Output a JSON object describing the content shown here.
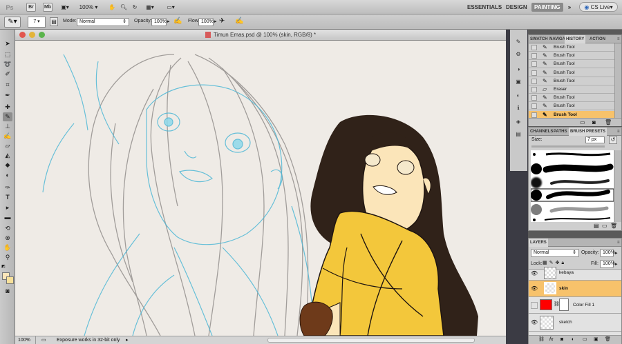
{
  "appbar": {
    "logo": "Ps",
    "zoom": "100%",
    "workspaces": [
      "ESSENTIALS",
      "DESIGN",
      "PAINTING"
    ],
    "active_workspace": "PAINTING",
    "cs_live": "CS Live"
  },
  "options": {
    "brush_size": "7",
    "mode_label": "Mode:",
    "mode_value": "Normal",
    "opacity_label": "Opacity:",
    "opacity_value": "100%",
    "flow_label": "Flow:",
    "flow_value": "100%"
  },
  "document": {
    "title": "Timun Emas.psd @ 100% (skin, RGB/8) *",
    "zoom": "100%",
    "status": "Exposure works in 32-bit only"
  },
  "history": {
    "tabs": [
      "SWATCH",
      "NAVIGA",
      "HISTORY",
      "ACTION"
    ],
    "active_tab": "HISTORY",
    "items": [
      "Brush Tool",
      "Brush Tool",
      "Brush Tool",
      "Brush Tool",
      "Brush Tool",
      "Eraser",
      "Brush Tool",
      "Brush Tool",
      "Brush Tool"
    ],
    "selected_index": 8
  },
  "brush_presets": {
    "tabs": [
      "CHANNELS",
      "PATHS",
      "BRUSH PRESETS"
    ],
    "active_tab": "BRUSH PRESETS",
    "size_label": "Size:",
    "size_value": "7 px"
  },
  "layers": {
    "title": "LAYERS",
    "blend_mode": "Normal",
    "opacity_label": "Opacity:",
    "opacity_value": "100%",
    "lock_label": "Lock:",
    "fill_label": "Fill:",
    "fill_value": "100%",
    "items": [
      {
        "name": "kebaya",
        "selected": false
      },
      {
        "name": "skin",
        "selected": true
      },
      {
        "name": "Color Fill 1",
        "selected": false
      },
      {
        "name": "sketch",
        "selected": false
      }
    ]
  },
  "colors": {
    "selection": "#f7c26b",
    "fill_swatch": "#ff0000",
    "kebaya": "#f3c73b",
    "skin": "#fbe5b9",
    "hair": "#302219"
  }
}
